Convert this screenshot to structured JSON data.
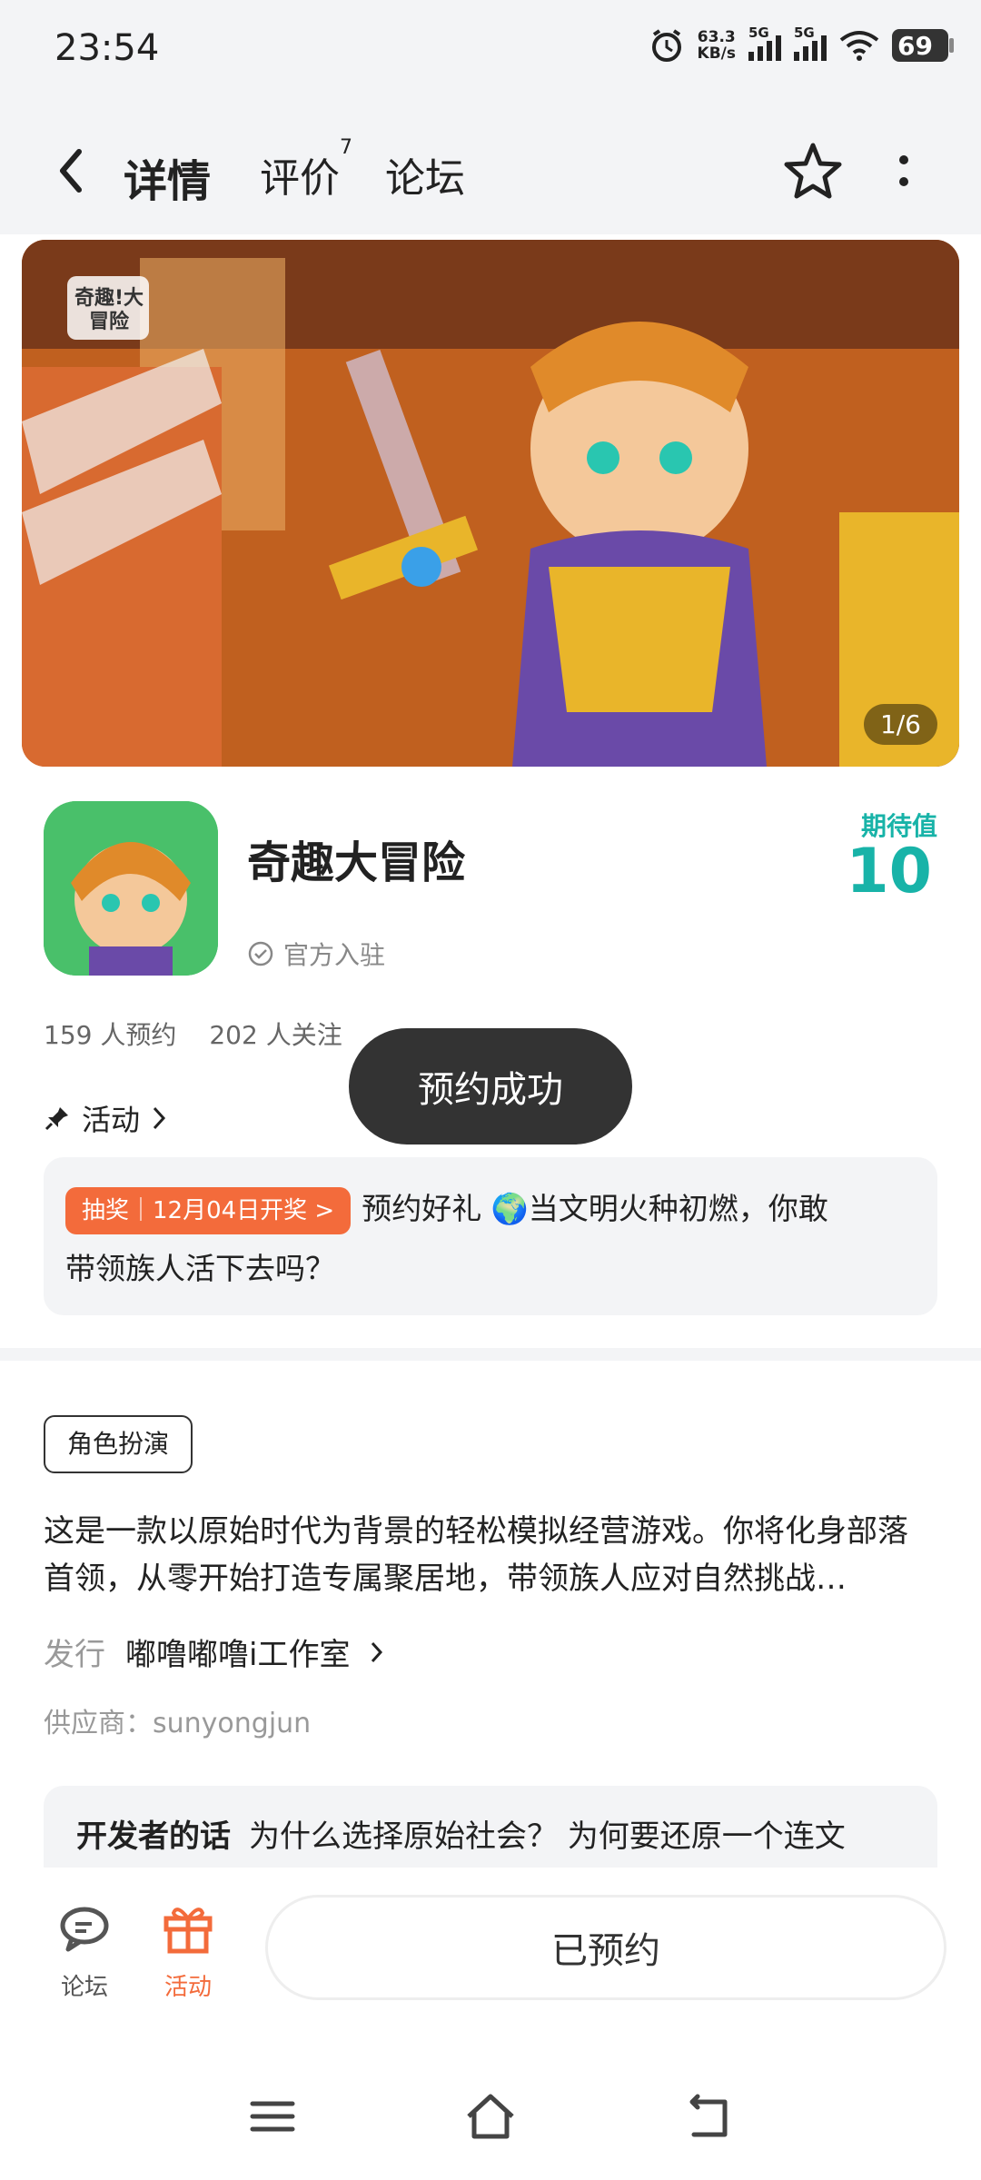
{
  "status_bar": {
    "time": "23:54",
    "speed_value": "63.3",
    "speed_unit": "KB/s",
    "net1": "5G",
    "net2": "5G",
    "battery": "69"
  },
  "nav": {
    "tabs": [
      {
        "label": "详情"
      },
      {
        "label": "评价",
        "badge": "7"
      },
      {
        "label": "论坛"
      }
    ]
  },
  "banner": {
    "counter": "1/6",
    "logo_text": "奇趣!大冒险"
  },
  "app": {
    "name": "奇趣大冒险",
    "official_label": "官方入驻",
    "expect_label": "期待值",
    "expect_value": "10",
    "reservations": "159 人预约",
    "followers": "202 人关注"
  },
  "activity": {
    "link_label": "活动",
    "badge": "抽奖｜12月04日开奖 >",
    "text_line1": "预约好礼 🌍当文明火种初燃，你敢",
    "text_line2": "带领族人活下去吗？"
  },
  "toast": "预约成功",
  "detail": {
    "genre": "角色扮演",
    "description": "这是一款以原始时代为背景的轻松模拟经营游戏。你将化身部落首领，从零开始打造专属聚居地，带领族人应对自然挑战…",
    "publisher_label": "发行",
    "publisher_value": "嘟噜嘟噜i工作室",
    "supplier": "供应商：sunyongjun",
    "dev_title": "开发者的话",
    "dev_text": "为什么选择原始社会？ 为何要还原一个连文"
  },
  "bottom_bar": {
    "forum_label": "论坛",
    "activity_label": "活动",
    "reserved_label": "已预约"
  },
  "colors": {
    "accent": "#18c6b8",
    "orange": "#f36b3b",
    "toast_bg": "#333333"
  }
}
